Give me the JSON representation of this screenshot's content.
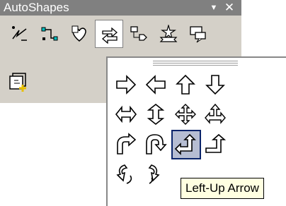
{
  "toolbar": {
    "title": "AutoShapes",
    "menu_glyph": "▼",
    "close_glyph": "✕",
    "categories": [
      {
        "name": "lines-icon"
      },
      {
        "name": "connectors-icon"
      },
      {
        "name": "basic-shapes-icon"
      },
      {
        "name": "block-arrows-icon",
        "active": true
      },
      {
        "name": "flowchart-icon"
      },
      {
        "name": "stars-banners-icon"
      },
      {
        "name": "callouts-icon"
      }
    ],
    "more": {
      "name": "more-autoshapes-icon"
    }
  },
  "palette": {
    "shapes": [
      {
        "name": "right-arrow",
        "icon": "right-arrow-icon"
      },
      {
        "name": "left-arrow",
        "icon": "left-arrow-icon"
      },
      {
        "name": "up-arrow",
        "icon": "up-arrow-icon"
      },
      {
        "name": "down-arrow",
        "icon": "down-arrow-icon"
      },
      {
        "name": "left-right-arrow",
        "icon": "left-right-arrow-icon"
      },
      {
        "name": "up-down-arrow",
        "icon": "up-down-arrow-icon"
      },
      {
        "name": "quad-arrow",
        "icon": "quad-arrow-icon"
      },
      {
        "name": "left-right-up-arrow",
        "icon": "left-right-up-arrow-icon"
      },
      {
        "name": "bent-arrow",
        "icon": "bent-arrow-icon"
      },
      {
        "name": "u-turn-arrow",
        "icon": "u-turn-arrow-icon"
      },
      {
        "name": "left-up-arrow",
        "icon": "left-up-arrow-icon",
        "hover": true
      },
      {
        "name": "bent-up-arrow",
        "icon": "bent-up-arrow-icon"
      },
      {
        "name": "curved-right-arrow",
        "icon": "curved-right-arrow-icon"
      },
      {
        "name": "curved-left-arrow",
        "icon": "curved-left-arrow-icon"
      }
    ]
  },
  "tooltip": {
    "text": "Left-Up Arrow"
  }
}
